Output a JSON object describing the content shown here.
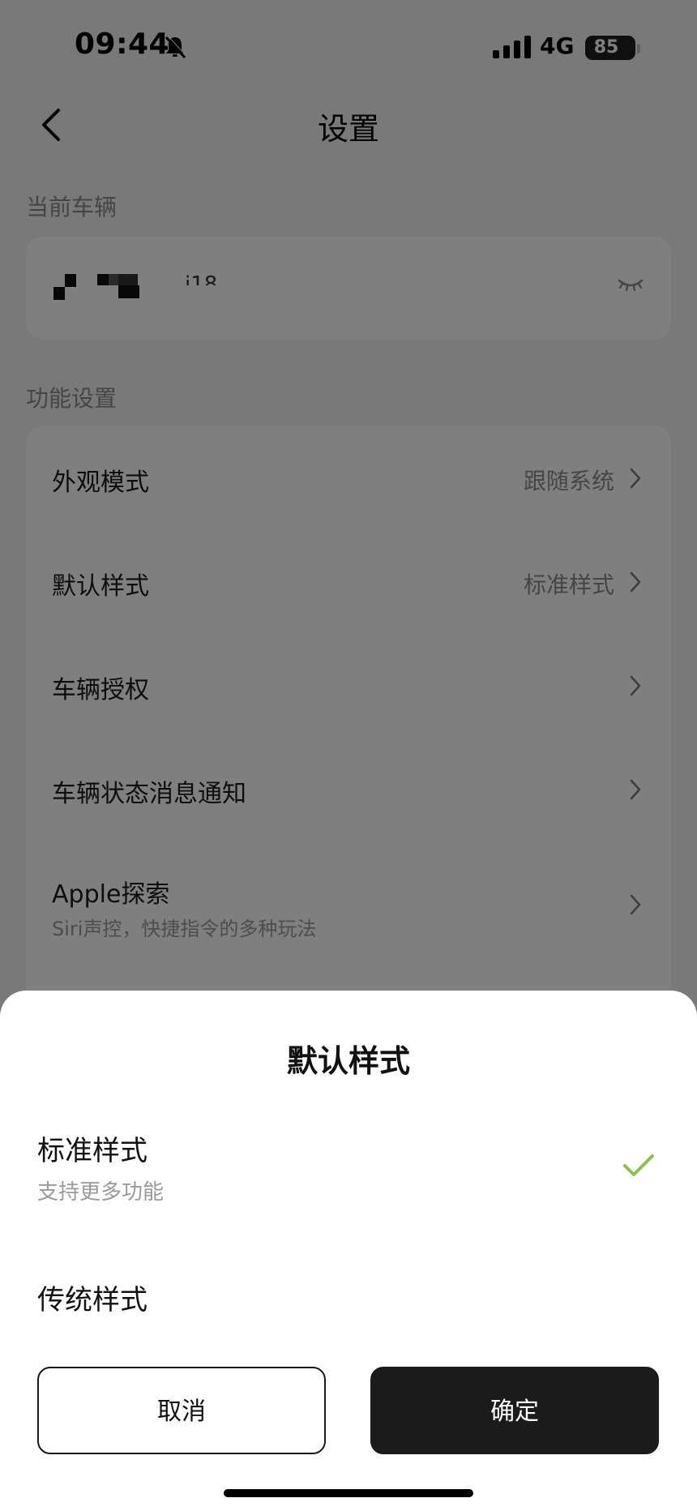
{
  "status_bar": {
    "time": "09:44",
    "network": "4G",
    "battery": "85",
    "icons": [
      "bell-muted-icon",
      "signal-icon",
      "battery-icon"
    ]
  },
  "nav": {
    "title": "设置",
    "back_icon": "chevron-left-icon"
  },
  "current_vehicle": {
    "section_label": "当前车辆",
    "name": "i18",
    "name_obscured": true,
    "visibility_icon": "eye-closed-icon"
  },
  "features": {
    "section_label": "功能设置",
    "rows": [
      {
        "label": "外观模式",
        "value": "跟随系统"
      },
      {
        "label": "默认样式",
        "value": "标准样式"
      },
      {
        "label": "车辆授权",
        "value": ""
      },
      {
        "label": "车辆状态消息通知",
        "value": ""
      },
      {
        "label": "Apple探索",
        "value": "",
        "subtitle": "Siri声控，快捷指令的多种玩法"
      }
    ]
  },
  "sheet": {
    "title": "默认样式",
    "options": [
      {
        "label": "标准样式",
        "subtitle": "支持更多功能",
        "selected": true
      },
      {
        "label": "传统样式",
        "subtitle": "",
        "selected": false
      }
    ],
    "cancel_label": "取消",
    "confirm_label": "确定",
    "check_color": "#8cc152"
  },
  "colors": {
    "overlay": "#000000",
    "confirm_bg": "#1b1b1b",
    "page_bg": "#f2f2f2"
  }
}
